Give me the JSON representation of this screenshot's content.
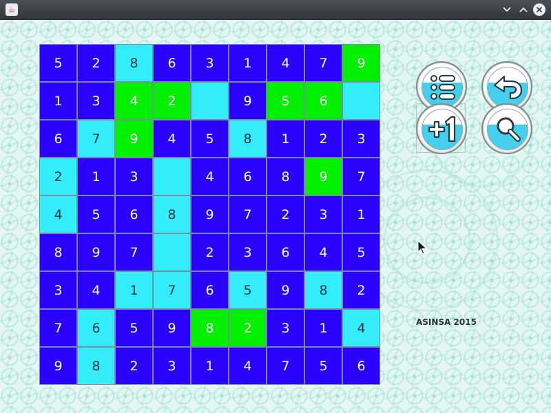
{
  "window": {
    "app_icon": "java-icon",
    "controls": [
      "minimize-icon",
      "maximize-icon",
      "close-icon"
    ]
  },
  "board": {
    "rows": [
      [
        {
          "v": "5",
          "c": "blue"
        },
        {
          "v": "2",
          "c": "blue"
        },
        {
          "v": "8",
          "c": "cyan"
        },
        {
          "v": "6",
          "c": "blue"
        },
        {
          "v": "3",
          "c": "blue"
        },
        {
          "v": "1",
          "c": "blue"
        },
        {
          "v": "4",
          "c": "blue"
        },
        {
          "v": "7",
          "c": "blue"
        },
        {
          "v": "9",
          "c": "green"
        }
      ],
      [
        {
          "v": "1",
          "c": "blue"
        },
        {
          "v": "3",
          "c": "blue"
        },
        {
          "v": "4",
          "c": "green"
        },
        {
          "v": "2",
          "c": "green"
        },
        {
          "v": "",
          "c": "cyan"
        },
        {
          "v": "9",
          "c": "blue"
        },
        {
          "v": "5",
          "c": "green"
        },
        {
          "v": "6",
          "c": "green"
        },
        {
          "v": "",
          "c": "cyan"
        }
      ],
      [
        {
          "v": "6",
          "c": "blue"
        },
        {
          "v": "7",
          "c": "cyan"
        },
        {
          "v": "9",
          "c": "green"
        },
        {
          "v": "4",
          "c": "blue"
        },
        {
          "v": "5",
          "c": "blue"
        },
        {
          "v": "8",
          "c": "cyan"
        },
        {
          "v": "1",
          "c": "blue"
        },
        {
          "v": "2",
          "c": "blue"
        },
        {
          "v": "3",
          "c": "blue"
        }
      ],
      [
        {
          "v": "2",
          "c": "cyan"
        },
        {
          "v": "1",
          "c": "blue"
        },
        {
          "v": "3",
          "c": "blue"
        },
        {
          "v": "",
          "c": "cyan"
        },
        {
          "v": "4",
          "c": "blue"
        },
        {
          "v": "6",
          "c": "blue"
        },
        {
          "v": "8",
          "c": "blue"
        },
        {
          "v": "9",
          "c": "green"
        },
        {
          "v": "7",
          "c": "blue"
        }
      ],
      [
        {
          "v": "4",
          "c": "cyan"
        },
        {
          "v": "5",
          "c": "blue"
        },
        {
          "v": "6",
          "c": "blue"
        },
        {
          "v": "8",
          "c": "cyan"
        },
        {
          "v": "9",
          "c": "blue"
        },
        {
          "v": "7",
          "c": "blue"
        },
        {
          "v": "2",
          "c": "blue"
        },
        {
          "v": "3",
          "c": "blue"
        },
        {
          "v": "1",
          "c": "blue"
        }
      ],
      [
        {
          "v": "8",
          "c": "blue"
        },
        {
          "v": "9",
          "c": "blue"
        },
        {
          "v": "7",
          "c": "blue"
        },
        {
          "v": "",
          "c": "cyan"
        },
        {
          "v": "2",
          "c": "blue"
        },
        {
          "v": "3",
          "c": "blue"
        },
        {
          "v": "6",
          "c": "blue"
        },
        {
          "v": "4",
          "c": "blue"
        },
        {
          "v": "5",
          "c": "blue"
        }
      ],
      [
        {
          "v": "3",
          "c": "blue"
        },
        {
          "v": "4",
          "c": "blue"
        },
        {
          "v": "1",
          "c": "cyan"
        },
        {
          "v": "7",
          "c": "cyan"
        },
        {
          "v": "6",
          "c": "blue"
        },
        {
          "v": "5",
          "c": "cyan"
        },
        {
          "v": "9",
          "c": "blue"
        },
        {
          "v": "8",
          "c": "cyan"
        },
        {
          "v": "2",
          "c": "blue"
        }
      ],
      [
        {
          "v": "7",
          "c": "blue"
        },
        {
          "v": "6",
          "c": "cyan"
        },
        {
          "v": "5",
          "c": "blue"
        },
        {
          "v": "9",
          "c": "blue"
        },
        {
          "v": "8",
          "c": "green"
        },
        {
          "v": "2",
          "c": "green"
        },
        {
          "v": "3",
          "c": "blue"
        },
        {
          "v": "1",
          "c": "blue"
        },
        {
          "v": "4",
          "c": "cyan"
        }
      ],
      [
        {
          "v": "9",
          "c": "blue"
        },
        {
          "v": "8",
          "c": "cyan"
        },
        {
          "v": "2",
          "c": "blue"
        },
        {
          "v": "3",
          "c": "blue"
        },
        {
          "v": "1",
          "c": "blue"
        },
        {
          "v": "4",
          "c": "blue"
        },
        {
          "v": "7",
          "c": "blue"
        },
        {
          "v": "5",
          "c": "blue"
        },
        {
          "v": "6",
          "c": "blue"
        }
      ]
    ],
    "colors": {
      "blue": "#2a00ff",
      "cyan": "#33eefa",
      "green": "#00f000"
    }
  },
  "controls": {
    "list_button_icon": "list-icon",
    "undo_button_icon": "undo-arrow-icon",
    "plus_one_button_icon": "plus-one-icon",
    "search_button_icon": "magnifier-icon",
    "accent_color": "#44d0ec"
  },
  "credit": {
    "text": "ASINSA 2015"
  }
}
